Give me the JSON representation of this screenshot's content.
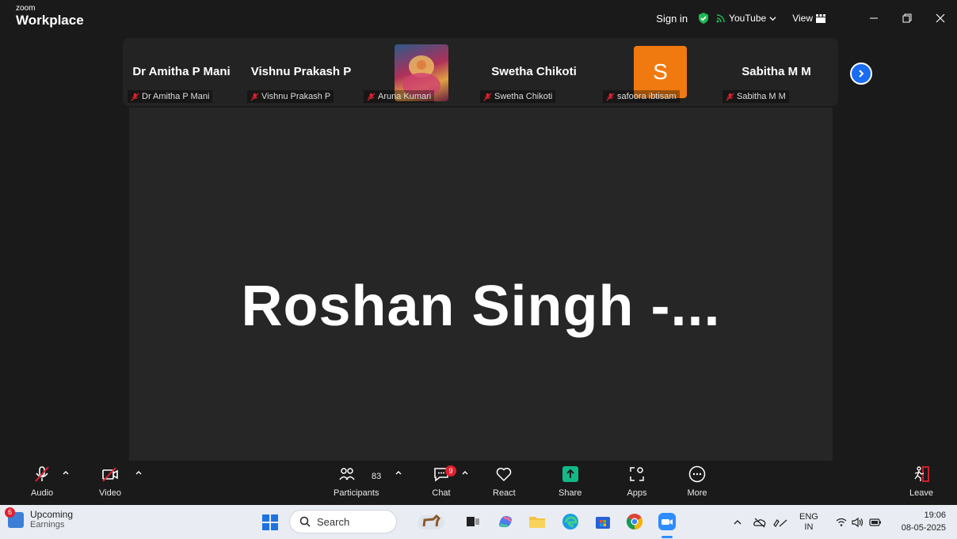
{
  "titlebar": {
    "brand_small": "zoom",
    "brand_large": "Workplace",
    "sign_in": "Sign in",
    "youtube": "YouTube",
    "view": "View",
    "accent_green": "#1db954"
  },
  "participants": [
    {
      "name": "Dr Amitha P Mani",
      "label": "Dr Amitha P Mani",
      "display": "name"
    },
    {
      "name": "Vishnu Prakash P",
      "label": "Vishnu Prakash P",
      "display": "name"
    },
    {
      "name": "Aruna Kumari",
      "label": "Aruna Kumari",
      "display": "photo"
    },
    {
      "name": "Swetha Chikoti",
      "label": "Swetha Chikoti",
      "display": "name"
    },
    {
      "name": "safoora ibtisam",
      "label": "safoora ibtisam",
      "display": "avatar",
      "avatar_letter": "S",
      "avatar_color": "#f07a10"
    },
    {
      "name": "Sabitha M M",
      "label": "Sabitha M M",
      "display": "name"
    }
  ],
  "stage": {
    "speaker_name": "Roshan Singh -..."
  },
  "toolbar": {
    "audio": "Audio",
    "video": "Video",
    "participants": "Participants",
    "participants_count": "83",
    "chat": "Chat",
    "chat_badge": "9",
    "react": "React",
    "share": "Share",
    "apps": "Apps",
    "more": "More",
    "leave": "Leave",
    "share_color": "#12b886",
    "leave_color": "#e0212f"
  },
  "taskbar": {
    "widget_badge": "6",
    "widget_title": "Upcoming",
    "widget_subtitle": "Earnings",
    "search_placeholder": "Search",
    "language_top": "ENG",
    "language_bottom": "IN",
    "time": "19:06",
    "date": "08-05-2025"
  }
}
